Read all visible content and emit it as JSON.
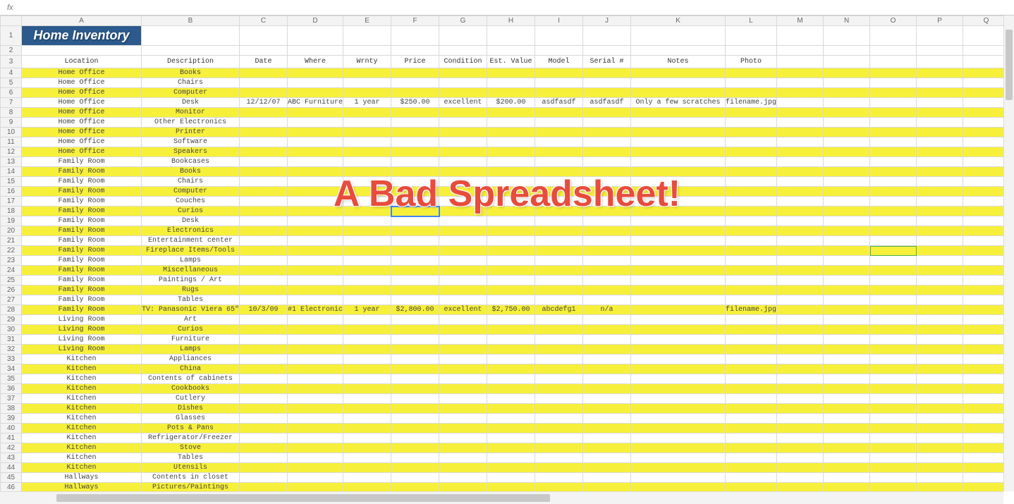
{
  "fx_label": "fx",
  "overlay": "A Bad Spreadsheet!",
  "columns": [
    "A",
    "B",
    "C",
    "D",
    "E",
    "F",
    "G",
    "H",
    "I",
    "J",
    "K",
    "L",
    "M",
    "N",
    "O",
    "P",
    "Q"
  ],
  "title": "Home Inventory",
  "headers": {
    "A": "Location",
    "B": "Description",
    "C": "Date",
    "D": "Where",
    "E": "Wrnty",
    "F": "Price",
    "G": "Condition",
    "H": "Est. Value",
    "I": "Model",
    "J": "Serial #",
    "K": "Notes",
    "L": "Photo"
  },
  "chart_data": {
    "type": "table",
    "columns": [
      "Location",
      "Description",
      "Date",
      "Where",
      "Wrnty",
      "Price",
      "Condition",
      "Est. Value",
      "Model",
      "Serial #",
      "Notes",
      "Photo"
    ],
    "title": "Home Inventory"
  },
  "rows": [
    {
      "n": 4,
      "y": true,
      "A": "Home Office",
      "B": "Books"
    },
    {
      "n": 5,
      "A": "Home Office",
      "B": "Chairs"
    },
    {
      "n": 6,
      "y": true,
      "A": "Home Office",
      "B": "Computer"
    },
    {
      "n": 7,
      "A": "Home Office",
      "B": "Desk",
      "C": "12/12/07",
      "D": "ABC Furniture",
      "E": "1 year",
      "F": "$250.00",
      "G": "excellent",
      "H": "$200.00",
      "I": "asdfasdf",
      "J": "asdfasdf",
      "K": "Only a few scratches",
      "L": "filename.jpg"
    },
    {
      "n": 8,
      "y": true,
      "A": "Home Office",
      "B": "Monitor"
    },
    {
      "n": 9,
      "A": "Home Office",
      "B": "Other Electronics"
    },
    {
      "n": 10,
      "y": true,
      "A": "Home Office",
      "B": "Printer"
    },
    {
      "n": 11,
      "A": "Home Office",
      "B": "Software"
    },
    {
      "n": 12,
      "y": true,
      "A": "Home Office",
      "B": "Speakers"
    },
    {
      "n": 13,
      "A": "Family Room",
      "B": "Bookcases"
    },
    {
      "n": 14,
      "y": true,
      "A": "Family Room",
      "B": "Books"
    },
    {
      "n": 15,
      "A": "Family Room",
      "B": "Chairs"
    },
    {
      "n": 16,
      "y": true,
      "A": "Family Room",
      "B": "Computer"
    },
    {
      "n": 17,
      "A": "Family Room",
      "B": "Couches"
    },
    {
      "n": 18,
      "y": true,
      "A": "Family Room",
      "B": "Curios"
    },
    {
      "n": 19,
      "A": "Family Room",
      "B": "Desk"
    },
    {
      "n": 20,
      "y": true,
      "A": "Family Room",
      "B": "Electronics"
    },
    {
      "n": 21,
      "A": "Family Room",
      "B": "Entertainment center"
    },
    {
      "n": 22,
      "y": true,
      "A": "Family Room",
      "B": "Fireplace Items/Tools"
    },
    {
      "n": 23,
      "A": "Family Room",
      "B": "Lamps"
    },
    {
      "n": 24,
      "y": true,
      "A": "Family Room",
      "B": "Miscellaneous"
    },
    {
      "n": 25,
      "A": "Family Room",
      "B": "Paintings / Art"
    },
    {
      "n": 26,
      "y": true,
      "A": "Family Room",
      "B": "Rugs"
    },
    {
      "n": 27,
      "A": "Family Room",
      "B": "Tables"
    },
    {
      "n": 28,
      "y": true,
      "A": "Family Room",
      "B": "TV: Panasonic Viera 65\"",
      "C": "10/3/09",
      "D": "#1 Electronic",
      "E": "1 year",
      "F": "$2,800.00",
      "G": "excellent",
      "H": "$2,750.00",
      "I": "abcdefg1",
      "J": "n/a",
      "L": "filename.jpg"
    },
    {
      "n": 29,
      "A": "Living Room",
      "B": "Art"
    },
    {
      "n": 30,
      "y": true,
      "A": "Living Room",
      "B": "Curios"
    },
    {
      "n": 31,
      "A": "Living Room",
      "B": "Furniture"
    },
    {
      "n": 32,
      "y": true,
      "A": "Living Room",
      "B": "Lamps"
    },
    {
      "n": 33,
      "A": "Kitchen",
      "B": "Appliances"
    },
    {
      "n": 34,
      "y": true,
      "A": "Kitchen",
      "B": "China"
    },
    {
      "n": 35,
      "A": "Kitchen",
      "B": "Contents of cabinets"
    },
    {
      "n": 36,
      "y": true,
      "A": "Kitchen",
      "B": "Cookbooks"
    },
    {
      "n": 37,
      "A": "Kitchen",
      "B": "Cutlery"
    },
    {
      "n": 38,
      "y": true,
      "A": "Kitchen",
      "B": "Dishes"
    },
    {
      "n": 39,
      "A": "Kitchen",
      "B": "Glasses"
    },
    {
      "n": 40,
      "y": true,
      "A": "Kitchen",
      "B": "Pots & Pans"
    },
    {
      "n": 41,
      "A": "Kitchen",
      "B": "Refrigerator/Freezer"
    },
    {
      "n": 42,
      "y": true,
      "A": "Kitchen",
      "B": "Stove"
    },
    {
      "n": 43,
      "A": "Kitchen",
      "B": "Tables"
    },
    {
      "n": 44,
      "y": true,
      "A": "Kitchen",
      "B": "Utensils"
    },
    {
      "n": 45,
      "A": "Hallways",
      "B": "Contents in closet"
    },
    {
      "n": 46,
      "y": true,
      "A": "Hallways",
      "B": "Pictures/Paintings"
    }
  ],
  "selected_cell": "F18",
  "secondary_sel": "O22"
}
